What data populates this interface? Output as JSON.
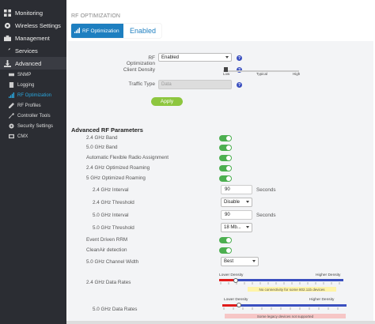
{
  "sidebar": {
    "items": [
      {
        "label": "Monitoring",
        "icon": "dashboard-icon"
      },
      {
        "label": "Wireless Settings",
        "icon": "gear-icon"
      },
      {
        "label": "Management",
        "icon": "briefcase-icon"
      },
      {
        "label": "Services",
        "icon": "wrench-icon"
      },
      {
        "label": "Advanced",
        "icon": "download-icon"
      }
    ],
    "subitems": [
      {
        "label": "SNMP",
        "icon": "snmp-icon"
      },
      {
        "label": "Logging",
        "icon": "log-icon"
      },
      {
        "label": "RF Optimization",
        "icon": "signal-icon"
      },
      {
        "label": "RF Profiles",
        "icon": "profile-icon"
      },
      {
        "label": "Controller Tools",
        "icon": "tools-icon"
      },
      {
        "label": "Security Settings",
        "icon": "shield-icon"
      },
      {
        "label": "CMX",
        "icon": "cmx-icon"
      }
    ]
  },
  "main": {
    "page_title": "RF OPTIMIZATION",
    "header_left": "RF Optimization",
    "header_right": "Enabled",
    "rf_optimization_label": "RF Optimization",
    "rf_optimization_value": "Enabled",
    "client_density_label": "Client Density",
    "density_low": "Low",
    "density_typical": "Typical",
    "density_high": "High",
    "traffic_type_label": "Traffic Type",
    "traffic_type_placeholder": "Data",
    "apply_label": "Apply",
    "help_glyph": "?"
  },
  "advanced": {
    "title": "Advanced RF Parameters",
    "toggles": [
      {
        "label": "2.4 GHz Band"
      },
      {
        "label": "5.0 GHz Band"
      },
      {
        "label": "Automatic Flexible Radio Assignment"
      },
      {
        "label": "2.4 GHz Optimized Roaming"
      },
      {
        "label": "5 GHz Optimized Roaming"
      }
    ],
    "interval24_label": "2.4 GHz Interval",
    "interval24_value": "90",
    "interval24_unit": "Seconds",
    "threshold24_label": "2.4 GHz Threshold",
    "threshold24_value": "Disable",
    "interval50_label": "5.0 GHz Interval",
    "interval50_value": "90",
    "interval50_unit": "Seconds",
    "threshold50_label": "5.0 GHz Threshold",
    "threshold50_value": "18 Mb...",
    "event_rrm_label": "Event Driven RRM",
    "cleanair_label": "CleanAir detection",
    "channel_width_label": "5.0 GHz Channel Width",
    "channel_width_value": "Best",
    "rates24_label": "2.4 GHz Data Rates",
    "rates24_lower": "Lower Density",
    "rates24_higher": "Higher Density",
    "rates24_warning": "No connectivity for some 802.11b devices",
    "rates50_label": "5.0 GHz Data Rates",
    "rates50_lower": "Lower Density",
    "rates50_higher": "Higher Density",
    "rates50_warning": "Some legacy devices not supported"
  },
  "colors": {
    "accent": "#1e7fc0",
    "toggle_on": "#4caf50",
    "apply": "#8dc63f",
    "slider": "#3a4fbf"
  }
}
